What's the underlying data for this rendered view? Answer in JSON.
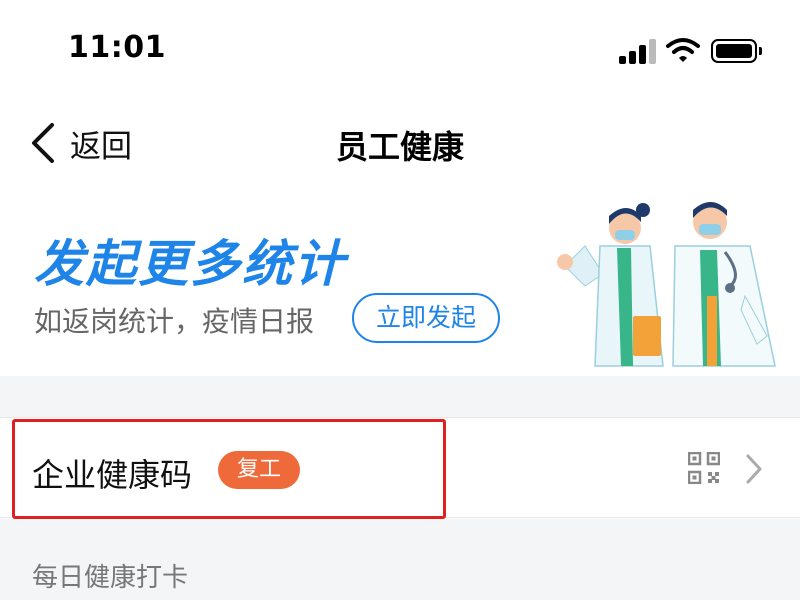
{
  "status_bar": {
    "time": "11:01",
    "icons": [
      "signal-icon",
      "wifi-icon",
      "battery-icon"
    ]
  },
  "nav": {
    "back_label": "返回",
    "title": "员工健康"
  },
  "banner": {
    "title": "发起更多统计",
    "subtitle": "如返岗统计，疫情日报",
    "button_label": "立即发起",
    "accent_color": "#1e84e8"
  },
  "list": {
    "health_code": {
      "label": "企业健康码",
      "badge": "复工",
      "badge_color": "#ef6a3b",
      "icons": [
        "qr-code-icon",
        "chevron-right-icon"
      ]
    },
    "daily_checkin": {
      "label": "每日健康打卡"
    }
  },
  "annotation": {
    "highlight_color": "#e02020"
  }
}
